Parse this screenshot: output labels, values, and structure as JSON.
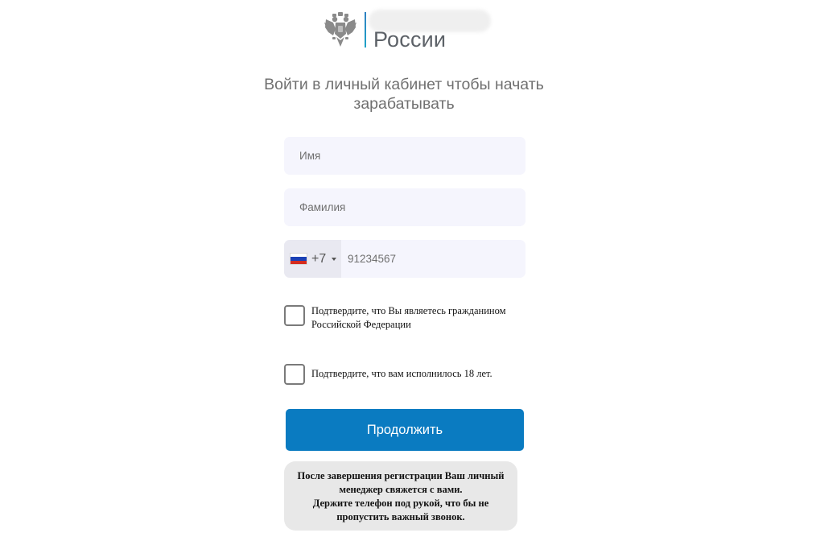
{
  "header": {
    "logo_text": "России",
    "emblem_icon": "double-headed-eagle-icon"
  },
  "heading": {
    "line1": "Войти в личный кабинет чтобы начать",
    "line2": "зарабатывать"
  },
  "form": {
    "name_placeholder": "Имя",
    "surname_placeholder": "Фамилия",
    "phone": {
      "country_flag": "russia-flag-icon",
      "dial_code": "+7",
      "placeholder": "91234567"
    },
    "citizen_checkbox_label": "Подтвердите, что Вы являетесь гражданином Российской Федерации",
    "age_checkbox_label": "Подтвердите, что вам исполнилось 18 лет.",
    "continue_label": "Продолжить"
  },
  "note": {
    "line1": "После завершения регистрации Ваш личный",
    "line2": "менеджер свяжется с вами.",
    "line3": "Держите телефон под рукой, что бы не",
    "line4": "пропустить важный звонок."
  },
  "colors": {
    "primary_button": "#0a7bc1",
    "input_background": "#f5f5fd",
    "note_background": "#e8e8e8",
    "heading_text": "#707070"
  }
}
